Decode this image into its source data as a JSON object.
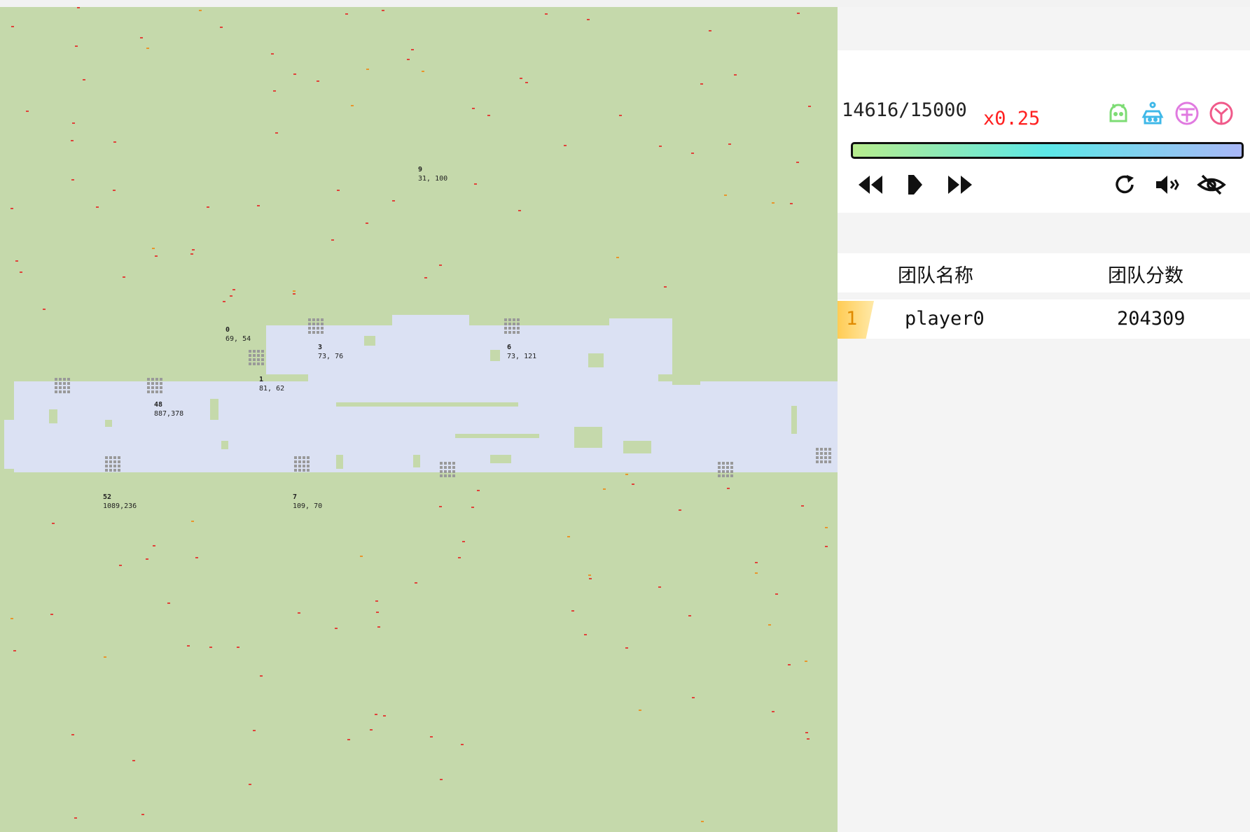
{
  "game": {
    "progress_text": "14616/15000",
    "progress_fraction": 0.9744,
    "speed_text": "x0.25"
  },
  "team_icons": [
    {
      "name": "android-icon",
      "color": "#7ddc74"
    },
    {
      "name": "robot-icon",
      "color": "#3fb8e8"
    },
    {
      "name": "drum-icon",
      "color": "#e07ae0"
    },
    {
      "name": "shield-icon",
      "color": "#f05a8a"
    }
  ],
  "controls": {
    "left": [
      "rewind-icon",
      "play-icon",
      "fast-forward-icon"
    ],
    "right": [
      "replay-icon",
      "volume-icon",
      "hide-eye-icon"
    ]
  },
  "leaderboard": {
    "headers": {
      "name": "团队名称",
      "score": "团队分数"
    },
    "rows": [
      {
        "rank": "1",
        "name": "player0",
        "score": "204309"
      }
    ]
  },
  "map": {
    "terrain_color": "#c5d9ab",
    "water_color": "#dbe1f3",
    "bases": [
      {
        "id": "9",
        "coords": "31, 100"
      },
      {
        "id": "0",
        "coords": "69, 54"
      },
      {
        "id": "3",
        "coords": "73, 76"
      },
      {
        "id": "6",
        "coords": "73, 121"
      },
      {
        "id": "1",
        "coords": "81, 62"
      },
      {
        "id": "48",
        "coords": "887,378"
      },
      {
        "id": "52",
        "coords": "1089,236"
      },
      {
        "id": "7",
        "coords": "109, 70"
      }
    ]
  }
}
